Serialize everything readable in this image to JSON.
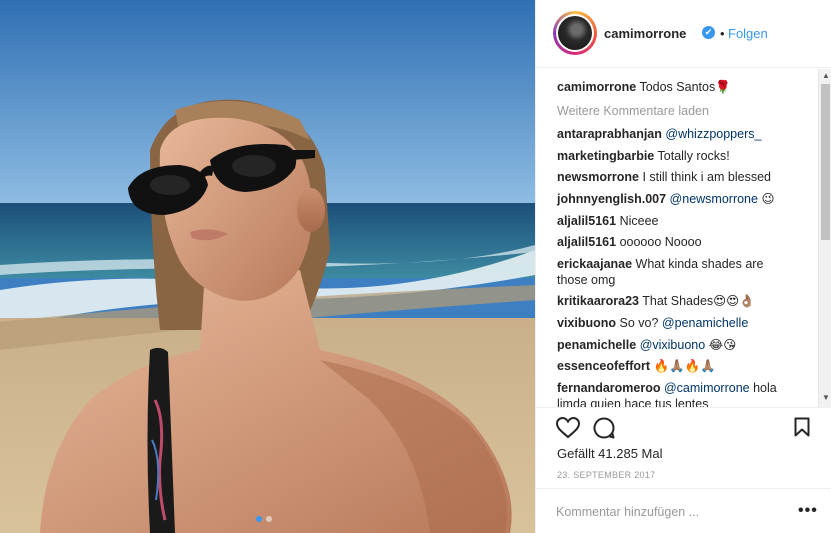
{
  "post": {
    "photo_alt": "woman with sunglasses on beach",
    "carousel_dots": 2,
    "carousel_active": 1
  },
  "header": {
    "username": "camimorrone",
    "verified_mark": "✔",
    "separator": "•",
    "follow_label": "Folgen"
  },
  "caption": {
    "user": "camimorrone",
    "text": "Todos Santos🌹"
  },
  "load_more_label": "Weitere Kommentare laden",
  "comments": [
    {
      "user": "antaraprabhanjan",
      "text": "",
      "mention": "@whizzpoppers_"
    },
    {
      "user": "marketingbarbie",
      "text": "Totally rocks!",
      "mention": ""
    },
    {
      "user": "newsmorrone",
      "text": "I still think i am blessed",
      "mention": ""
    },
    {
      "user": "johnnyenglish.007",
      "text": "",
      "mention": "@newsmorrone",
      "after": " 😉"
    },
    {
      "user": "aljalil5161",
      "text": "Niceee",
      "mention": ""
    },
    {
      "user": "aljalil5161",
      "text": "oooooo Noooo",
      "mention": ""
    },
    {
      "user": "erickaajanae",
      "text": "What kinda shades are those omg",
      "mention": ""
    },
    {
      "user": "kritikaarora23",
      "text": "That Shades😍😍👌🏽",
      "mention": ""
    },
    {
      "user": "vixibuono",
      "text": "So vo?",
      "mention": "@penamichelle"
    },
    {
      "user": "penamichelle",
      "text": "",
      "mention": "@vixibuono",
      "after": " 😂😘"
    },
    {
      "user": "essenceofeffort",
      "text": "🔥🙏🏽🔥🙏🏽",
      "mention": ""
    },
    {
      "user": "fernandaromeroo",
      "text": "",
      "mention": "@camimorrone",
      "after": " hola limda quien hace tus lentes"
    }
  ],
  "actions": {
    "like_icon": "heart-icon",
    "comment_icon": "speech-bubble-icon",
    "save_icon": "bookmark-icon"
  },
  "likes_text": "Gefällt 41.285 Mal",
  "date_text": "23. SEPTEMBER 2017",
  "add_comment_placeholder": "Kommentar hinzufügen ...",
  "options_label": "•••",
  "colors": {
    "link": "#3897f0",
    "mention": "#003569",
    "muted": "#999999",
    "text": "#262626"
  }
}
